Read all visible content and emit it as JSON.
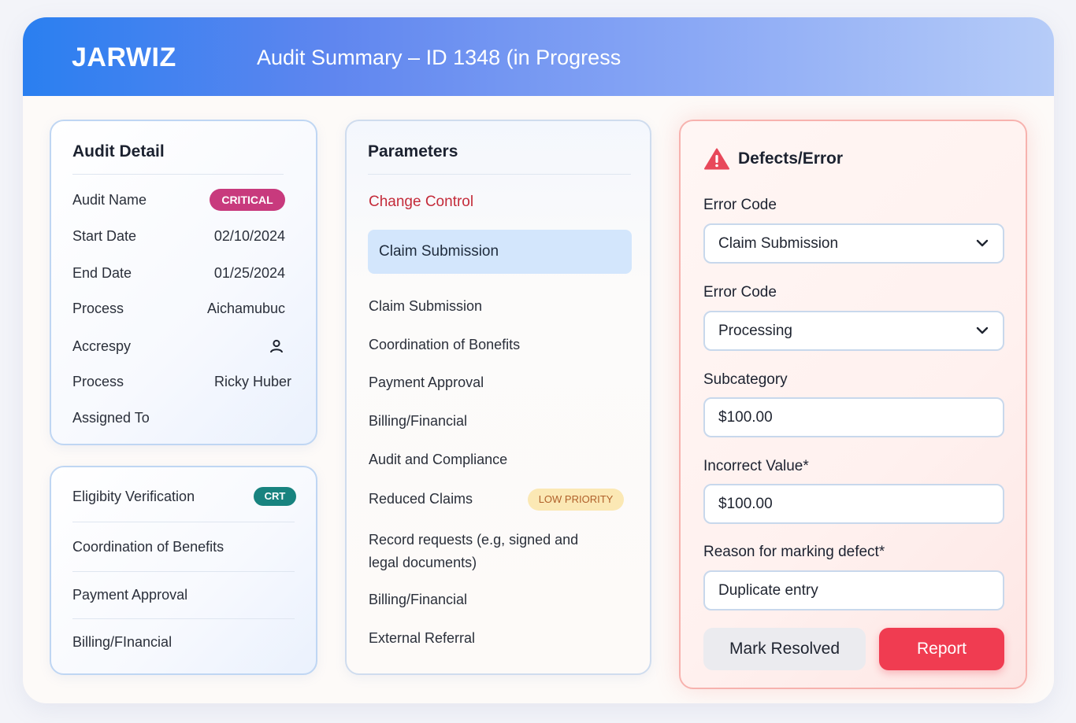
{
  "header": {
    "brand": "JARWIZ",
    "title": "Audit Summary – ID 1348 (in Progress"
  },
  "audit_detail": {
    "title": "Audit Detail",
    "badge": "CRITICAL",
    "rows": [
      {
        "label": "Audit Name",
        "value": ""
      },
      {
        "label": "Start Date",
        "value": "02/10/2024"
      },
      {
        "label": "End Date",
        "value": "01/25/2024"
      },
      {
        "label": "Process",
        "value": "Aichamubuc"
      },
      {
        "label": "Accrespy",
        "value": ""
      },
      {
        "label": "Process",
        "value": "Ricky Huber"
      },
      {
        "label": "Assigned To",
        "value": ""
      }
    ],
    "assignee_icon": "user-icon"
  },
  "secondary_list": {
    "badge": "CRT",
    "items": [
      "Eligibity Verification",
      "Coordination of Benefits",
      "Payment Approval",
      "Billing/FInancial"
    ]
  },
  "parameters": {
    "title": "Parameters",
    "change_control": "Change Control",
    "selected": "Claim Submission",
    "items": [
      "Claim Submission",
      "Coordination of Bonefits",
      "Payment Approval",
      "Billing/Financial",
      "Audit and Compliance",
      "Reduced Claims",
      "Record requests (e.g, signed and legal documents)",
      "Billing/Financial",
      "External Referral"
    ],
    "low_priority_badge": "LOW PRIORITY"
  },
  "defects": {
    "title": "Defects/Error",
    "icon": "warning-icon",
    "error_code_1_label": "Error Code",
    "error_code_1_value": "Claim Submission",
    "error_code_2_label": "Error Code",
    "error_code_2_value": "Processing",
    "subcategory_label": "Subcategory",
    "subcategory_value": "$100.00",
    "incorrect_value_label": "Incorrect Value*",
    "incorrect_value_value": "$100.00",
    "reason_label": "Reason for marking defect*",
    "reason_value": "Duplicate entry",
    "resolve_button": "Mark Resolved",
    "report_button": "Report"
  },
  "colors": {
    "header_start": "#2a7ff0",
    "critical_badge": "#c83a7d",
    "crt_badge": "#18837f",
    "report_button": "#f03c51",
    "change_control": "#c42b3a"
  }
}
